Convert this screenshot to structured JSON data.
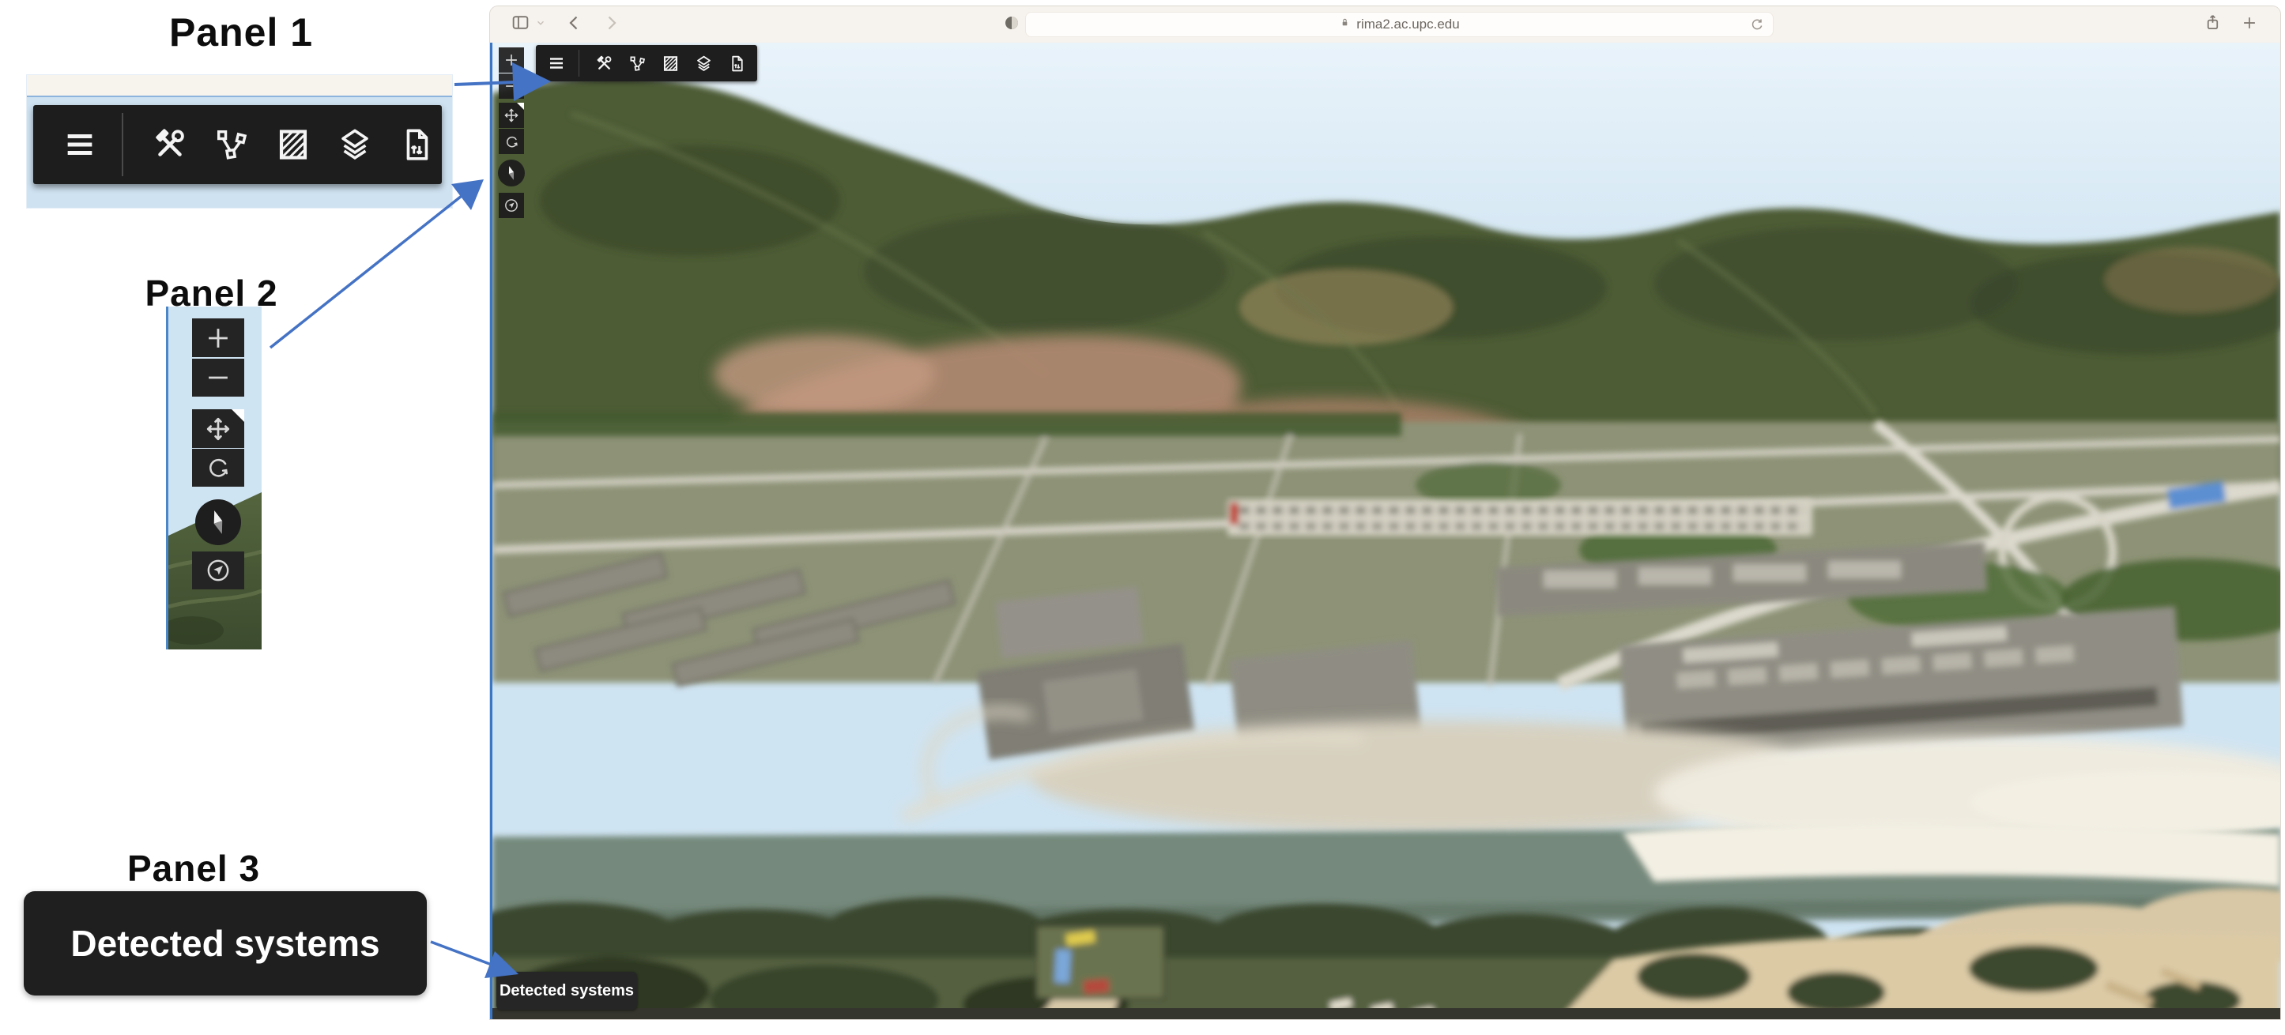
{
  "annotations": {
    "panel1_label": "Panel 1",
    "panel2_label": "Panel 2",
    "panel3_label": "Panel 3",
    "panel3_button_label": "Detected systems",
    "arrow_color": "#4472c4"
  },
  "browser": {
    "url": "rima2.ac.upc.edu",
    "chrome_icons": [
      "sidebar-icon",
      "chevron-down-icon",
      "back-icon",
      "forward-icon",
      "shield-icon",
      "lock-icon",
      "reload-icon",
      "share-icon",
      "new-tab-icon"
    ]
  },
  "map": {
    "top_toolbar_icons": [
      "menu-icon",
      "tools-icon",
      "route-icon",
      "hatch-icon",
      "layers-icon",
      "file-transfer-icon"
    ],
    "side_toolbar_icons": [
      "zoom-in-icon",
      "zoom-out-icon",
      "pan-icon",
      "rotate-icon",
      "compass-icon",
      "locate-icon"
    ],
    "detected_systems_label": "Detected systems",
    "scene_colors": {
      "sky": "#cfe4f2",
      "mountain": "#4d5c36",
      "town_roofs": "#b18a72",
      "river": "#74897c",
      "sand": "#dccaa5"
    }
  }
}
